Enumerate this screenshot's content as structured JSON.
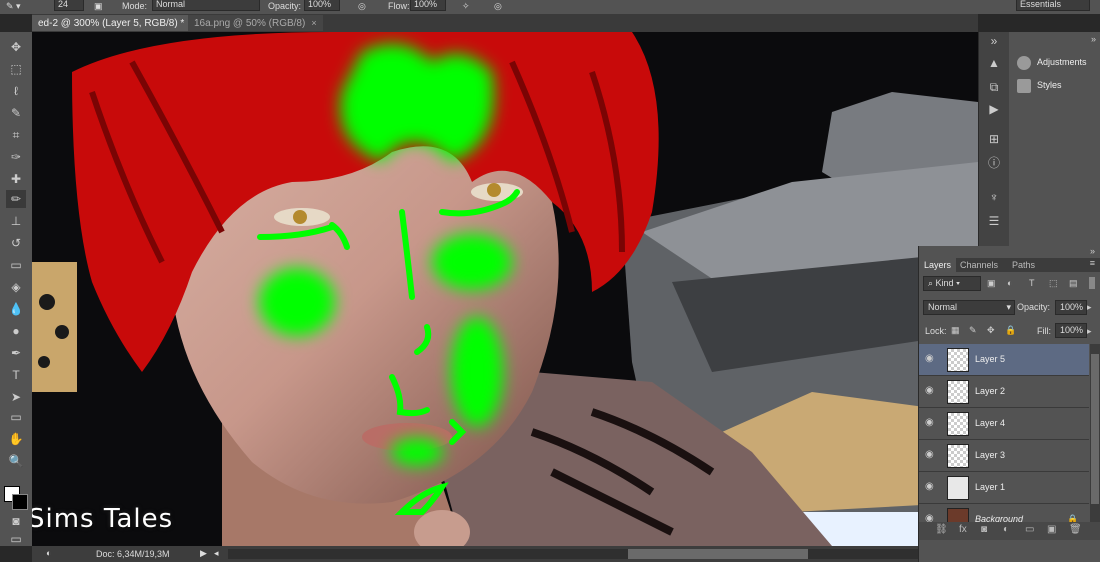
{
  "options_bar": {
    "brush_size": "24",
    "mode_label": "Mode:",
    "mode_value": "Normal",
    "opacity_label": "Opacity:",
    "opacity_value": "100%",
    "flow_label": "Flow:",
    "flow_value": "100%",
    "workspace": "Essentials"
  },
  "tabs": [
    {
      "label": "ed-2 @ 300% (Layer 5, RGB/8) *",
      "active": true
    },
    {
      "label": "16a.png @ 50% (RGB/8)",
      "active": false
    }
  ],
  "tools": [
    "move-tool",
    "marquee-tool",
    "lasso-tool",
    "quick-select-tool",
    "crop-tool",
    "eyedropper-tool",
    "healing-brush-tool",
    "brush-tool",
    "clone-stamp-tool",
    "history-brush-tool",
    "eraser-tool",
    "paint-bucket-tool",
    "blur-tool",
    "dodge-tool",
    "pen-tool",
    "type-tool",
    "path-select-tool",
    "shape-tool",
    "hand-tool",
    "zoom-tool"
  ],
  "status": {
    "doc": "Doc: 6,34M/19,3M"
  },
  "watermark": "Sims Tales",
  "right_panel": {
    "adjustments": "Adjustments",
    "styles": "Styles"
  },
  "layers_panel": {
    "tabs": [
      "Layers",
      "Channels",
      "Paths"
    ],
    "kind_label": "Kind",
    "blend_mode": "Normal",
    "opacity_label": "Opacity:",
    "opacity_value": "100%",
    "lock_label": "Lock:",
    "fill_label": "Fill:",
    "fill_value": "100%",
    "layers": [
      {
        "name": "Layer 5",
        "selected": true
      },
      {
        "name": "Layer 2",
        "selected": false
      },
      {
        "name": "Layer 4",
        "selected": false
      },
      {
        "name": "Layer 3",
        "selected": false
      },
      {
        "name": "Layer 1",
        "selected": false
      },
      {
        "name": "Background",
        "selected": false
      }
    ]
  },
  "colors": {
    "accent_green": "#00ff00",
    "hair_red": "#c80a0a",
    "selection_blue": "#5d6a83"
  }
}
